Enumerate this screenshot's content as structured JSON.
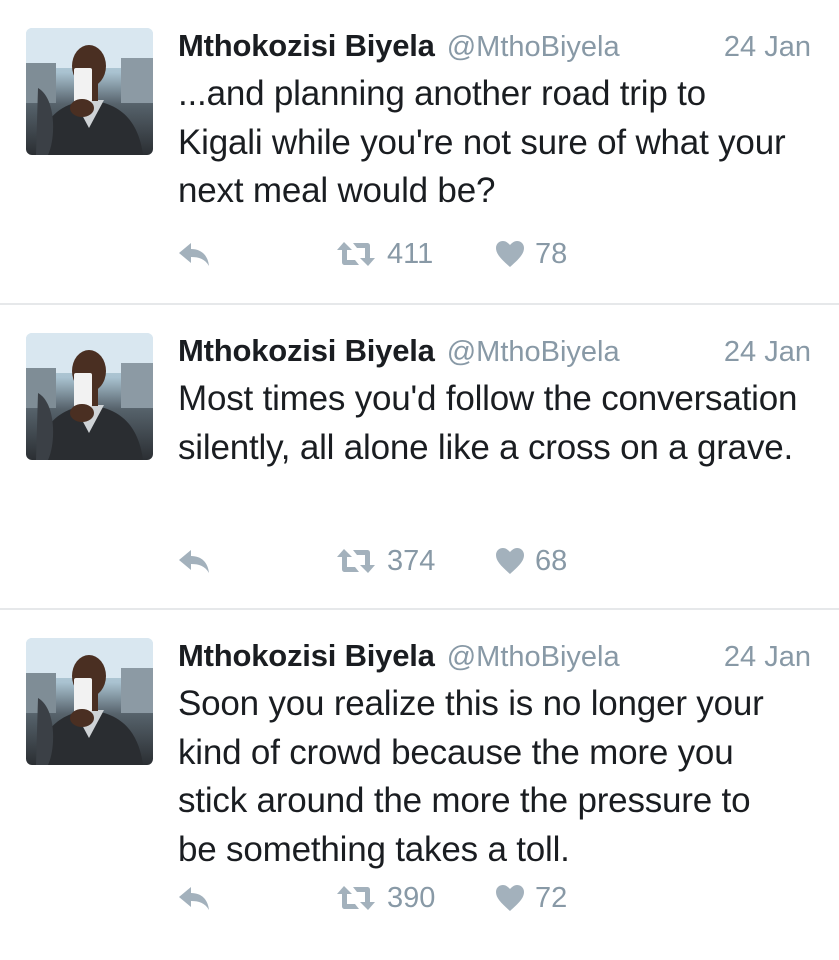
{
  "tweets": [
    {
      "name": "Mthokozisi Biyela",
      "handle": "@MthoBiyela",
      "date": "24 Jan",
      "text": "...and planning another road trip to Kigali while you're not sure of what your next meal would be?",
      "retweets": "411",
      "likes": "78"
    },
    {
      "name": "Mthokozisi Biyela",
      "handle": "@MthoBiyela",
      "date": "24 Jan",
      "text": "Most times you'd follow the conversation silently, all alone like a cross on a grave.",
      "retweets": "374",
      "likes": "68"
    },
    {
      "name": "Mthokozisi Biyela",
      "handle": "@MthoBiyela",
      "date": "24 Jan",
      "text": "Soon you realize this is no longer your kind of crowd because the more you stick around the more the pressure to be something takes a toll.",
      "retweets": "390",
      "likes": "72"
    }
  ],
  "icons": {
    "reply": "reply-icon",
    "retweet": "retweet-icon",
    "like": "heart-icon"
  },
  "colors": {
    "text": "#1a1d21",
    "muted": "#8899a6",
    "divider": "#e6e8ea",
    "icon": "#a3b1bc"
  }
}
